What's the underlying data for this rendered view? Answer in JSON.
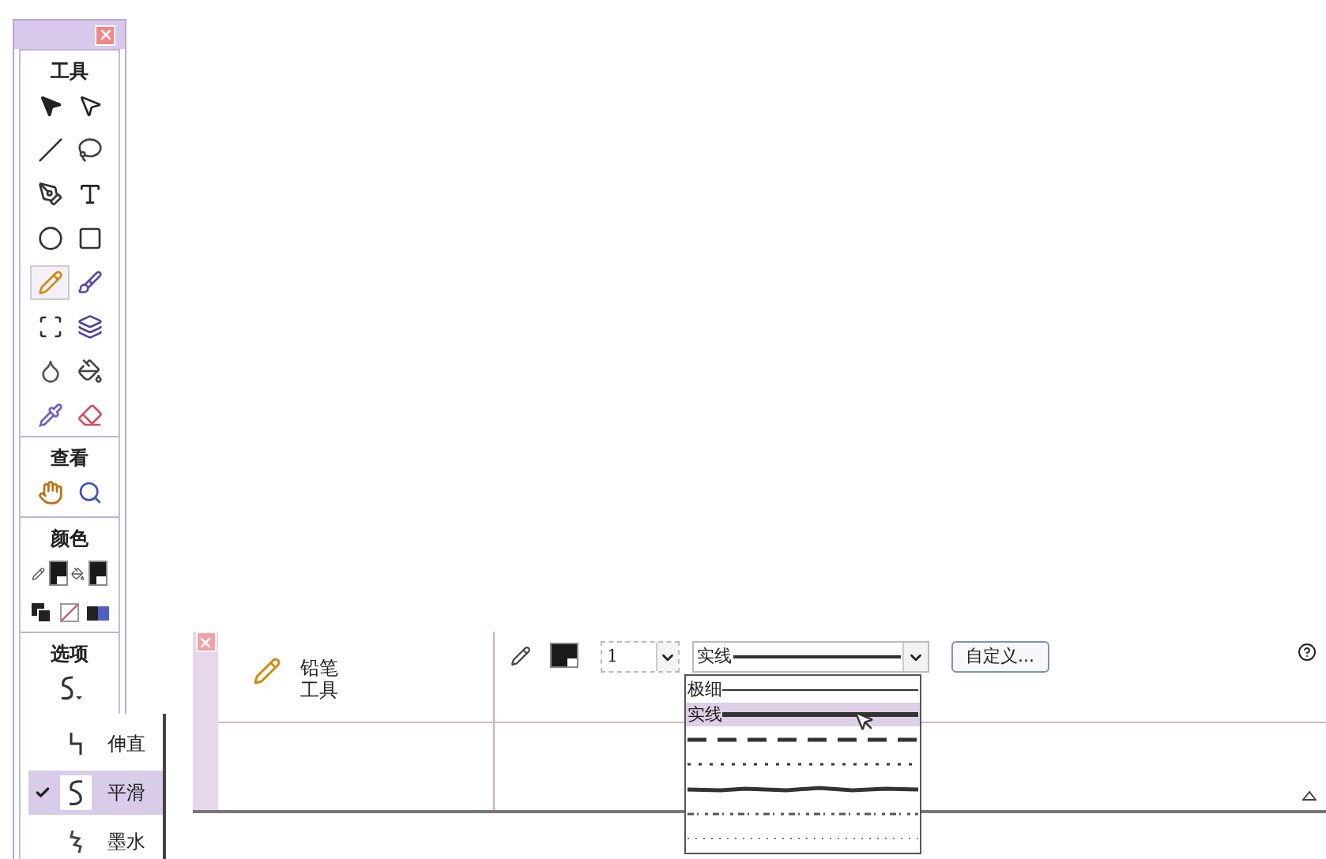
{
  "toolbox": {
    "sections": [
      {
        "title": "工具",
        "tools": [
          {
            "selected": false
          },
          {
            "selected": false
          },
          {
            "selected": false
          },
          {
            "selected": false
          },
          {
            "selected": false
          },
          {
            "selected": false
          },
          {
            "selected": false
          },
          {
            "selected": false
          },
          {
            "selected": true
          },
          {
            "selected": false
          },
          {
            "selected": false
          },
          {
            "selected": false
          },
          {
            "selected": false
          },
          {
            "selected": false
          },
          {
            "selected": false
          },
          {
            "selected": false
          }
        ]
      },
      {
        "title": "查看",
        "tools": [
          {
            "selected": false
          },
          {
            "selected": false
          }
        ]
      },
      {
        "title": "颜色",
        "tools": [
          {
            "selected": false
          },
          {
            "selected": false
          },
          {
            "selected": false
          },
          {
            "selected": false
          },
          {
            "selected": false
          }
        ]
      },
      {
        "title": "选项",
        "tools": [
          {
            "selected": false
          }
        ]
      }
    ]
  },
  "smooth_menu": {
    "items": [
      {
        "label": "伸直",
        "selected": false
      },
      {
        "label": "平滑",
        "selected": true
      },
      {
        "label": "墨水",
        "selected": false
      }
    ]
  },
  "properties": {
    "tool_name": "铅笔工具",
    "stroke_size": "1",
    "stroke_style": "实线",
    "custom_button": "自定义...",
    "style_options": [
      {
        "kind": "hairline",
        "label": "极细",
        "selected": false
      },
      {
        "kind": "solid",
        "label": "实线",
        "selected": true
      },
      {
        "kind": "dashed",
        "selected": false
      },
      {
        "kind": "dotted",
        "selected": false
      },
      {
        "kind": "ragged",
        "selected": false
      },
      {
        "kind": "stipple",
        "selected": false
      },
      {
        "kind": "hatched",
        "selected": false
      }
    ]
  }
}
